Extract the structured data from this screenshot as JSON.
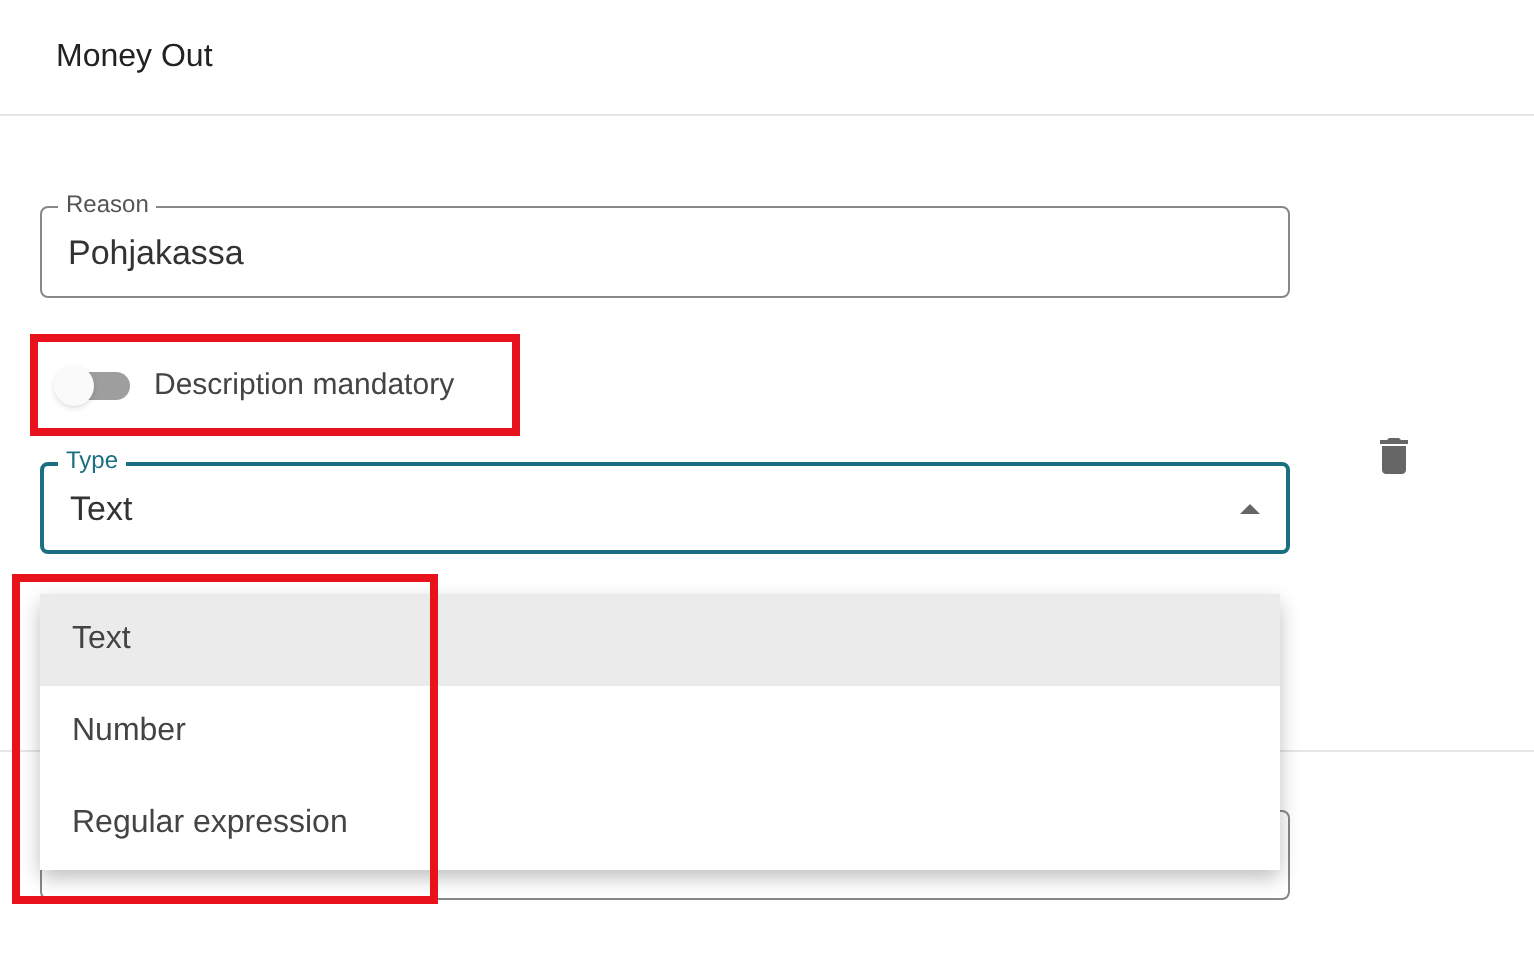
{
  "header": {
    "title": "Money Out"
  },
  "reason": {
    "label": "Reason",
    "value": "Pohjakassa"
  },
  "description_mandatory": {
    "label": "Description mandatory",
    "on": false
  },
  "type": {
    "label": "Type",
    "value": "Text",
    "expanded": true
  },
  "type_menu": [
    {
      "label": "Text",
      "selected": true
    },
    {
      "label": "Number",
      "selected": false
    },
    {
      "label": "Regular expression",
      "selected": false
    }
  ]
}
